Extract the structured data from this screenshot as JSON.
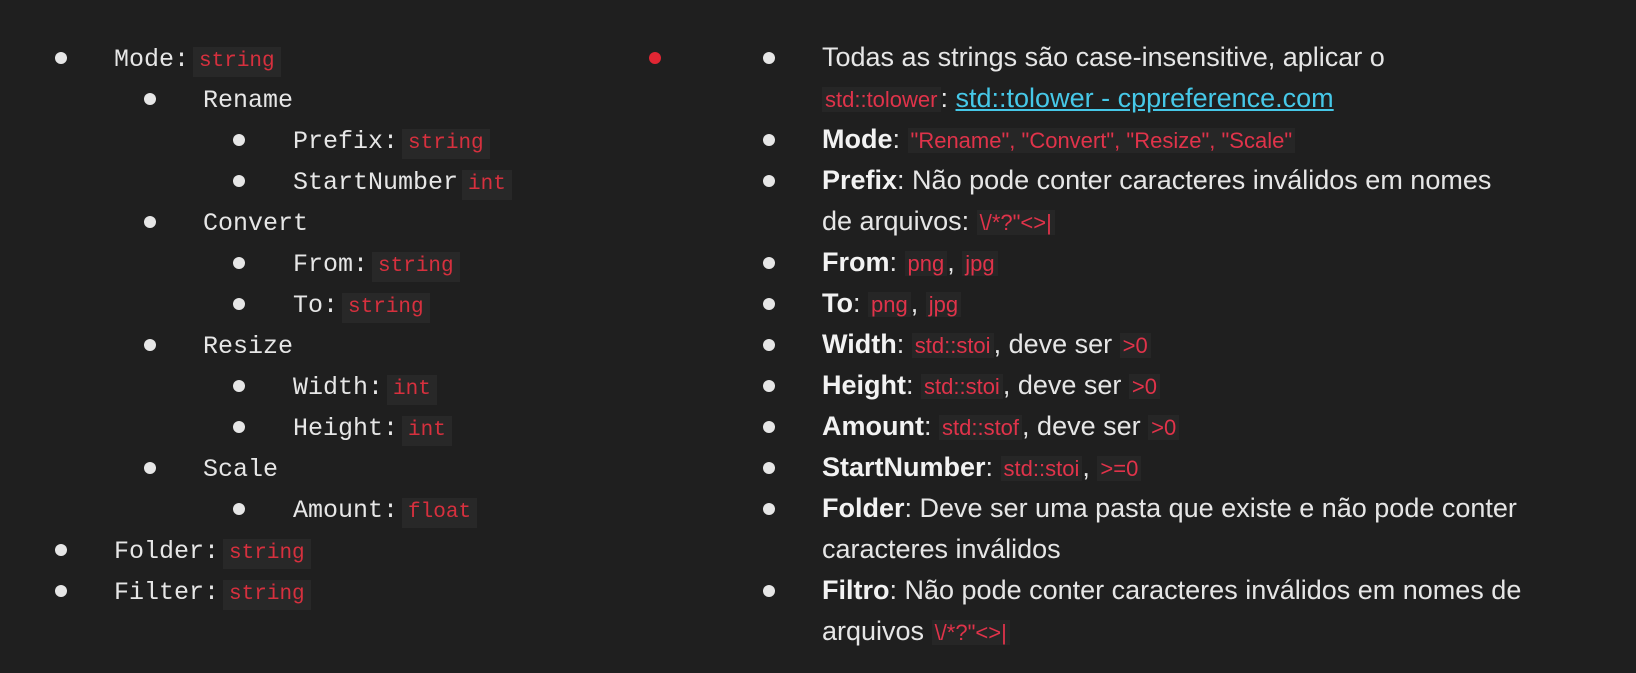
{
  "left": {
    "mode": {
      "key": "Mode:",
      "type": "string"
    },
    "rename": {
      "label": "Rename",
      "prefix": {
        "key": "Prefix:",
        "type": "string"
      },
      "start_number": {
        "key": "StartNumber",
        "type": "int"
      }
    },
    "convert": {
      "label": "Convert",
      "from": {
        "key": "From:",
        "type": "string"
      },
      "to": {
        "key": "To:",
        "type": "string"
      }
    },
    "resize": {
      "label": "Resize",
      "width": {
        "key": "Width:",
        "type": "int"
      },
      "height": {
        "key": "Height:",
        "type": "int"
      }
    },
    "scale": {
      "label": "Scale",
      "amount": {
        "key": "Amount:",
        "type": "float"
      }
    },
    "folder": {
      "key": "Folder:",
      "type": "string"
    },
    "filter": {
      "key": "Filter:",
      "type": "string"
    }
  },
  "right": {
    "strings": {
      "text": "Todas as strings são case-insensitive, aplicar o",
      "code": "std::tolower",
      "sep": ": ",
      "link": "std::tolower - cppreference.com"
    },
    "mode": {
      "key": "Mode",
      "values": "\"Rename\", \"Convert\", \"Resize\", \"Scale\""
    },
    "prefix": {
      "key": "Prefix",
      "text1": ": Não pode conter caracteres inválidos em nomes",
      "text2": "de arquivos: ",
      "chars": "\\/*?\"<>|"
    },
    "from": {
      "key": "From",
      "v1": "png",
      "v2": "jpg"
    },
    "to": {
      "key": "To",
      "v1": "png",
      "v2": "jpg"
    },
    "width": {
      "key": "Width",
      "fn": "std::stoi",
      "text": ", deve ser ",
      "cond": ">0"
    },
    "height": {
      "key": "Height",
      "fn": "std::stoi",
      "text": ", deve ser ",
      "cond": ">0"
    },
    "amount": {
      "key": "Amount",
      "fn": "std::stof",
      "text": ", deve ser ",
      "cond": ">0"
    },
    "start_number": {
      "key": "StartNumber",
      "fn": "std::stoi",
      "cond": ">=0"
    },
    "folder": {
      "key": "Folder",
      "text1": ": Deve ser uma pasta que existe e não pode conter",
      "text2": "caracteres inválidos"
    },
    "filtro": {
      "key": "Filtro",
      "text1": ": Não pode conter caracteres inválidos em nomes de",
      "text2": "arquivos ",
      "chars": "\\/*?\"<>|"
    }
  },
  "colors": {
    "background": "#1f1f1f",
    "text": "#e6e6e6",
    "code": "#e0334a",
    "link": "#46c8e8",
    "marker": "#e02633"
  }
}
